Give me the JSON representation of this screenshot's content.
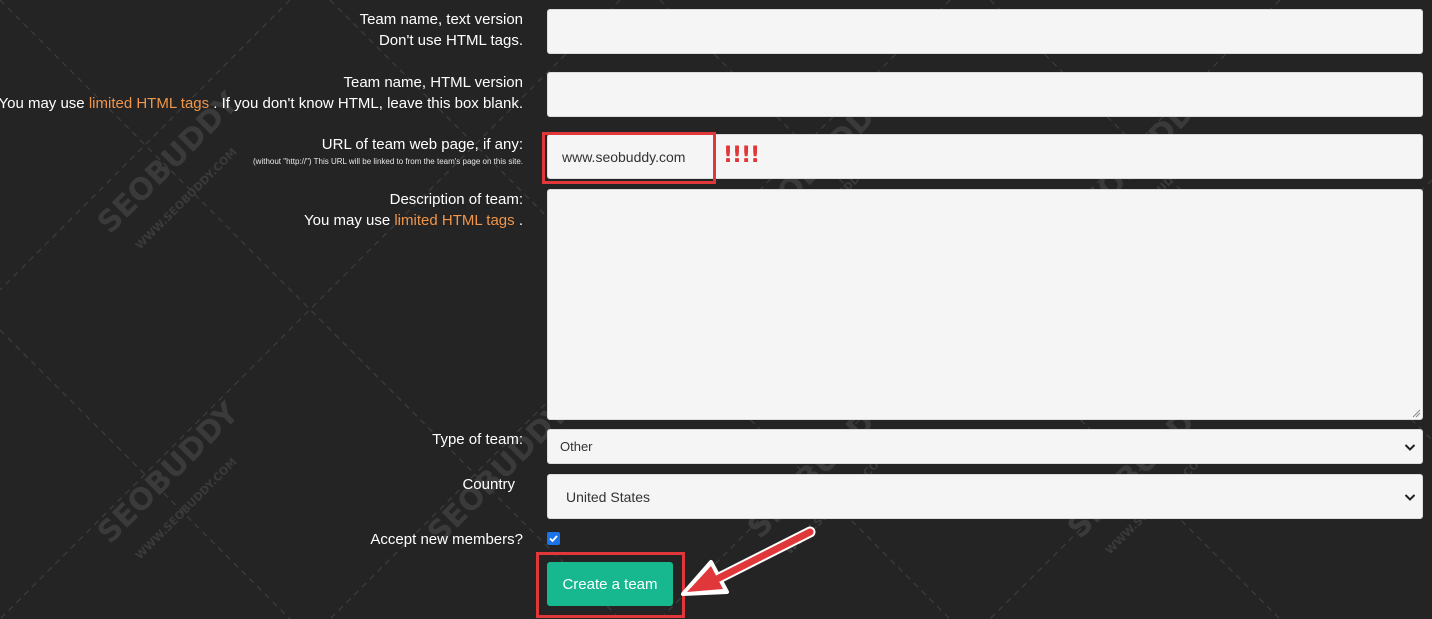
{
  "form": {
    "team_name_text": {
      "label": "Team name, text version",
      "hint": "Don't use HTML tags.",
      "value": ""
    },
    "team_name_html": {
      "label": "Team name, HTML version",
      "hint_prefix": "You may use ",
      "hint_link": "limited HTML tags",
      "hint_suffix": " . If you don't know HTML, leave this box blank.",
      "value": ""
    },
    "url": {
      "label": "URL of team web page, if any:",
      "hint": "(without \"http://\") This URL will be linked to from the team's page on this site.",
      "value": "www.seobuddy.com",
      "marker": "!!!!"
    },
    "description": {
      "label": "Description of team:",
      "hint_prefix": "You may use ",
      "hint_link": "limited HTML tags",
      "hint_suffix": " .",
      "value": ""
    },
    "team_type": {
      "label": "Type of team:",
      "selected": "Other"
    },
    "country": {
      "label": "Country",
      "selected": "United States"
    },
    "accept_members": {
      "label": "Accept new members?",
      "checked": true
    },
    "submit_label": "Create a team"
  },
  "watermark": {
    "brand": "SEOBUDDY",
    "url": "WWW.SEOBUDDY.COM"
  },
  "colors": {
    "background": "#242424",
    "link": "#f0954a",
    "button": "#17b890",
    "highlight": "#e0383a"
  },
  "icons": [
    "chevron-down-icon",
    "checkmark-icon",
    "resize-handle-icon",
    "arrow-annotation-icon"
  ]
}
